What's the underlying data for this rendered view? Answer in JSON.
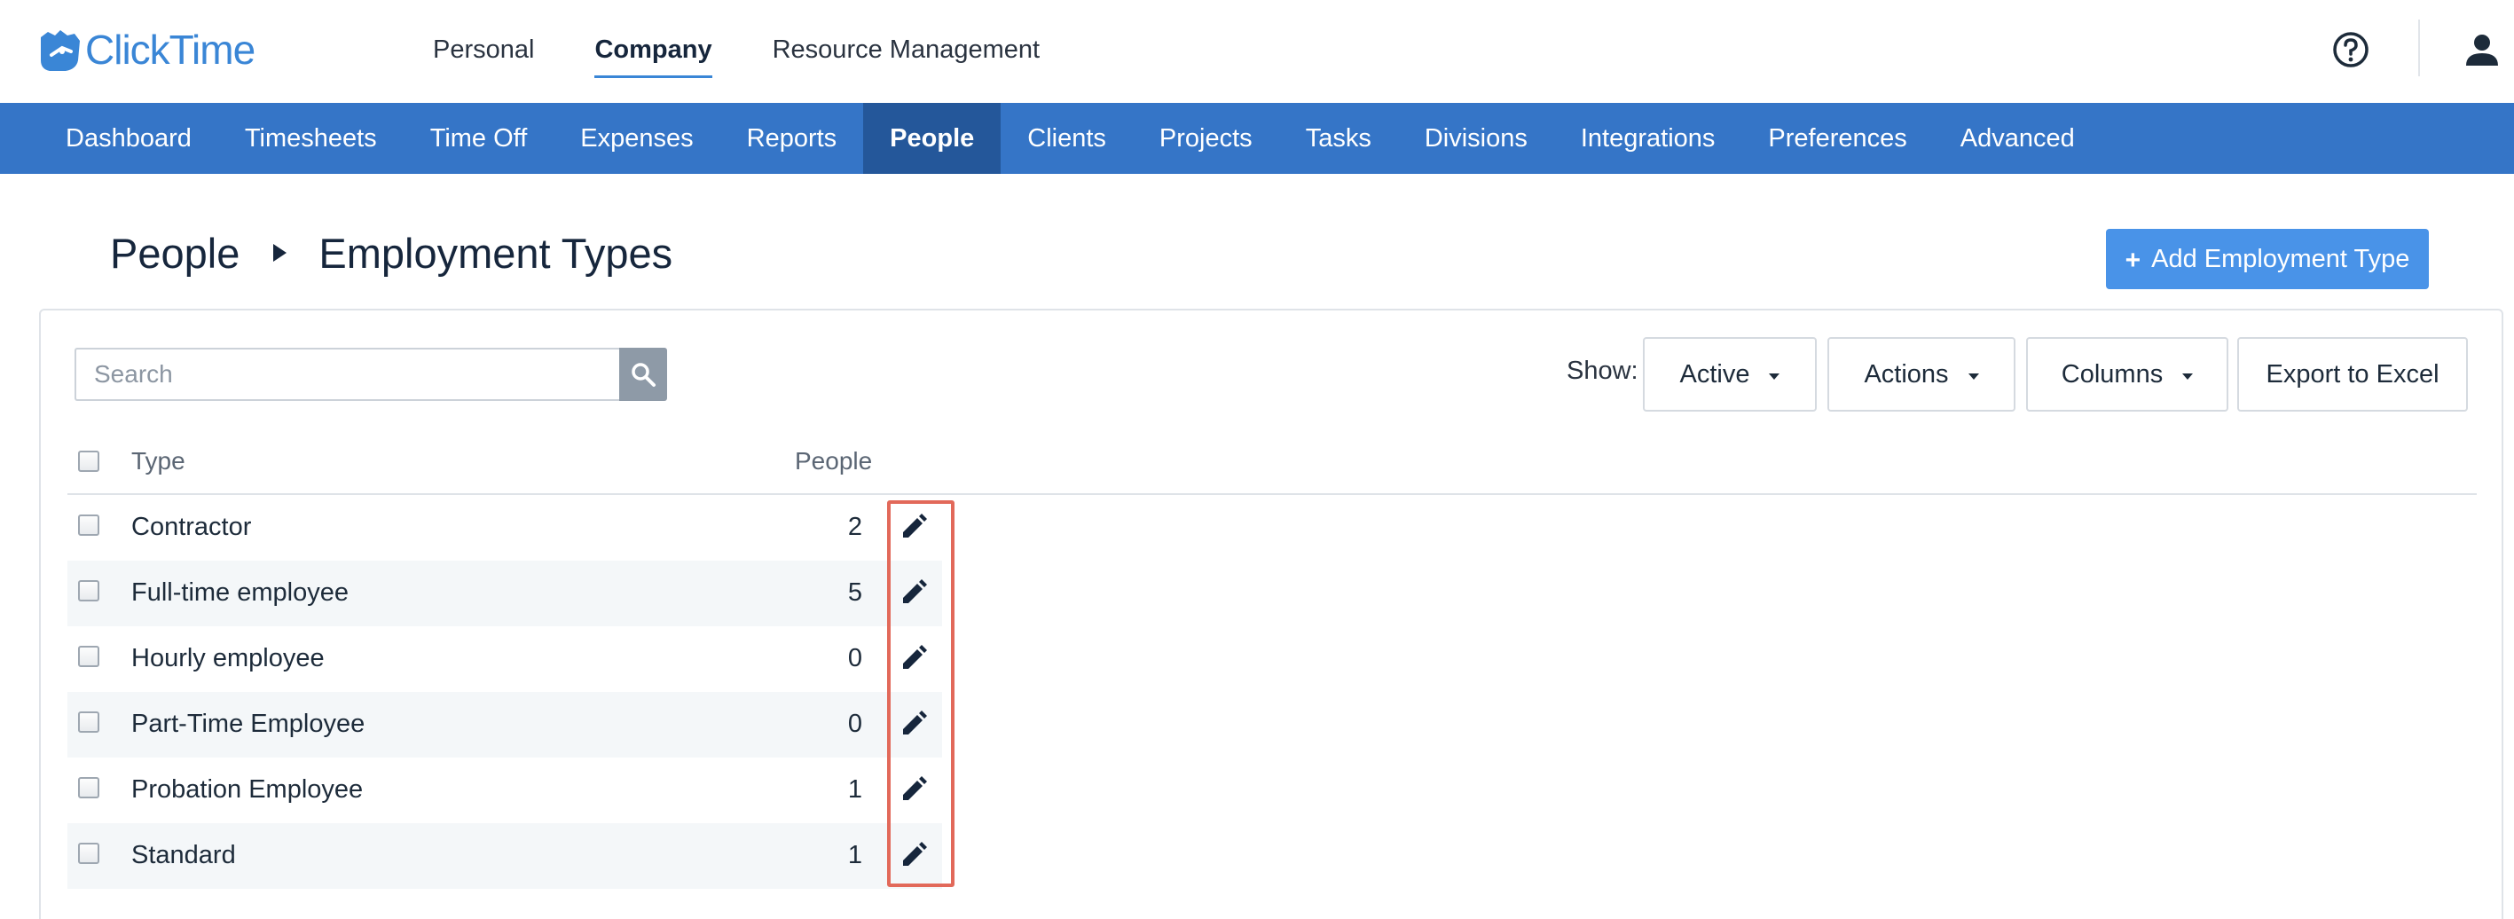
{
  "app": {
    "name": "ClickTime"
  },
  "top_nav": {
    "items": [
      "Personal",
      "Company",
      "Resource Management"
    ],
    "active_index": 1
  },
  "main_nav": {
    "items": [
      "Dashboard",
      "Timesheets",
      "Time Off",
      "Expenses",
      "Reports",
      "People",
      "Clients",
      "Projects",
      "Tasks",
      "Divisions",
      "Integrations",
      "Preferences",
      "Advanced"
    ],
    "active": "People"
  },
  "breadcrumb": {
    "parent": "People",
    "current": "Employment Types"
  },
  "add_button": {
    "label": "Add Employment Type",
    "icon": "plus-icon"
  },
  "search": {
    "placeholder": "Search",
    "value": ""
  },
  "toolbar": {
    "show_label": "Show:",
    "show_value": "Active",
    "actions_label": "Actions",
    "columns_label": "Columns",
    "export_label": "Export to Excel"
  },
  "table": {
    "columns": [
      "Type",
      "People"
    ],
    "rows": [
      {
        "type": "Contractor",
        "people": "2"
      },
      {
        "type": "Full-time employee",
        "people": "5"
      },
      {
        "type": "Hourly employee",
        "people": "0"
      },
      {
        "type": "Part-Time Employee",
        "people": "0"
      },
      {
        "type": "Probation Employee",
        "people": "1"
      },
      {
        "type": "Standard",
        "people": "1"
      }
    ]
  },
  "icons": {
    "logo": "clicktime-logo-icon",
    "help": "help-circle-icon",
    "user": "user-icon",
    "search": "search-icon",
    "edit": "pencil-icon"
  },
  "colors": {
    "brand": "#3a86d6",
    "nav_bar": "#3575c7",
    "nav_active": "#24579a",
    "primary_button": "#4993e8",
    "highlight": "#e2695a"
  }
}
